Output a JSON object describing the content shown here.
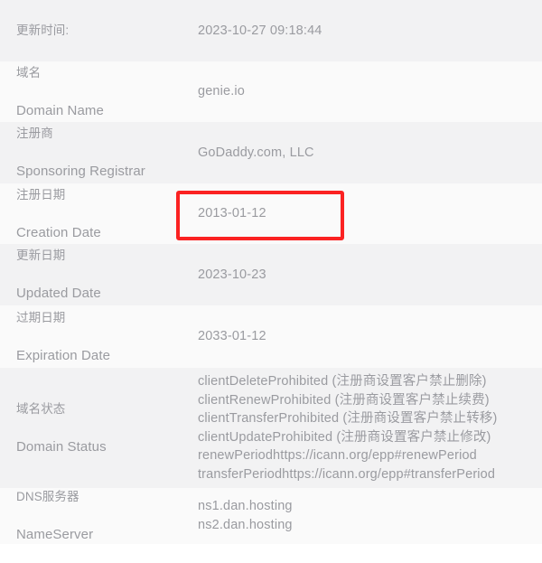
{
  "table": {
    "rows": [
      {
        "label_cn": "更新时间:",
        "label_en": "",
        "value": "2023-10-27 09:18:44"
      },
      {
        "label_cn": "域名",
        "label_en": "Domain Name",
        "value": "genie.io"
      },
      {
        "label_cn": "注册商",
        "label_en": "Sponsoring Registrar",
        "value": "GoDaddy.com, LLC"
      },
      {
        "label_cn": "注册日期",
        "label_en": "Creation Date",
        "value": "2013-01-12"
      },
      {
        "label_cn": "更新日期",
        "label_en": "Updated Date",
        "value": "2023-10-23"
      },
      {
        "label_cn": "过期日期",
        "label_en": "Expiration Date",
        "value": "2033-01-12"
      },
      {
        "label_cn": "域名状态",
        "label_en": "Domain Status",
        "value": ""
      },
      {
        "label_cn": "DNS服务器",
        "label_en": "NameServer",
        "value": ""
      }
    ]
  },
  "domain_status": {
    "lines": [
      "clientDeleteProhibited (注册商设置客户禁止删除)",
      "clientRenewProhibited (注册商设置客户禁止续费)",
      "clientTransferProhibited (注册商设置客户禁止转移)",
      "clientUpdateProhibited (注册商设置客户禁止修改)",
      "renewPeriodhttps://icann.org/epp#renewPeriod",
      "transferPeriodhttps://icann.org/epp#transferPeriod"
    ]
  },
  "nameservers": {
    "lines": [
      "ns1.dan.hosting",
      "ns2.dan.hosting"
    ]
  },
  "annotation": {
    "highlight_color": "#fb2222",
    "highlights": "creation-date-value"
  },
  "colors": {
    "row_dark": "#f2f2f3",
    "row_light": "#fafafa",
    "text": "#9a9ba0",
    "page_background": "#ffffff"
  }
}
